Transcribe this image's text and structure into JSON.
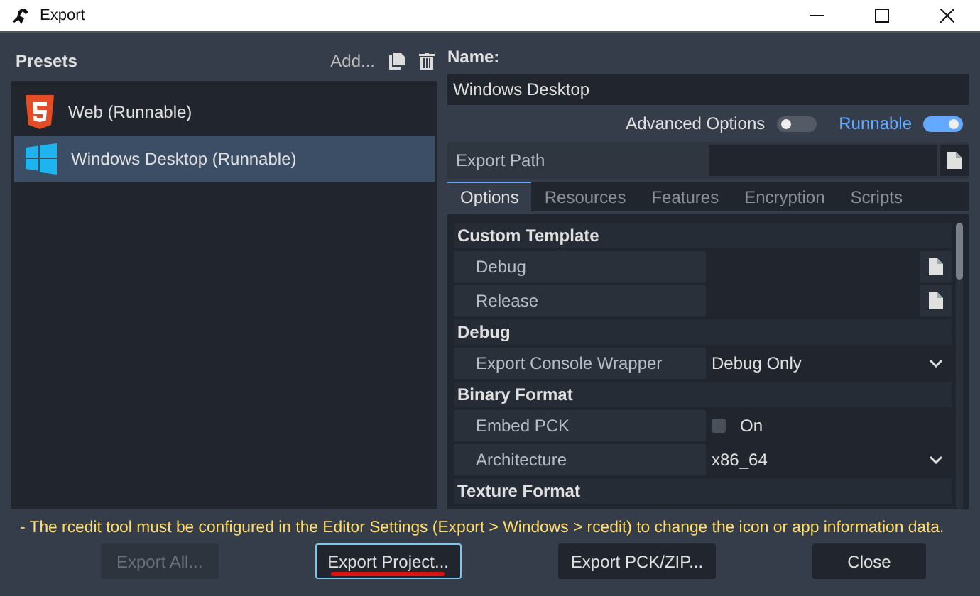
{
  "window": {
    "title": "Export"
  },
  "presets": {
    "title": "Presets",
    "add_label": "Add...",
    "items": [
      {
        "label": "Web (Runnable)",
        "kind": "html5",
        "selected": false
      },
      {
        "label": "Windows Desktop (Runnable)",
        "kind": "windows",
        "selected": true
      }
    ]
  },
  "name": {
    "label": "Name:",
    "value": "Windows Desktop"
  },
  "toggles": [
    {
      "label": "Advanced Options",
      "on": false
    },
    {
      "label": "Runnable",
      "on": true
    }
  ],
  "export_path": {
    "label": "Export Path"
  },
  "tabs": [
    {
      "label": "Options",
      "selected": true
    },
    {
      "label": "Resources",
      "selected": false
    },
    {
      "label": "Features",
      "selected": false
    },
    {
      "label": "Encryption",
      "selected": false
    },
    {
      "label": "Scripts",
      "selected": false
    }
  ],
  "properties": [
    {
      "kind": "section",
      "label": "Custom Template"
    },
    {
      "kind": "file",
      "label": "Debug"
    },
    {
      "kind": "file",
      "label": "Release"
    },
    {
      "kind": "section",
      "label": "Debug"
    },
    {
      "kind": "dropdown",
      "label": "Export Console Wrapper",
      "value": "Debug Only"
    },
    {
      "kind": "section",
      "label": "Binary Format"
    },
    {
      "kind": "checkbox",
      "label": "Embed PCK",
      "value": "On",
      "checked": false
    },
    {
      "kind": "dropdown",
      "label": "Architecture",
      "value": "x86_64"
    },
    {
      "kind": "section",
      "label": "Texture Format"
    }
  ],
  "warning": "- The rcedit tool must be configured in the Editor Settings (Export > Windows > rcedit) to change the icon or app information data.",
  "buttons": [
    {
      "label": "Export All...",
      "disabled": true,
      "focused": false
    },
    {
      "label": "Export Project...",
      "disabled": false,
      "focused": true
    },
    {
      "label": "Export PCK/ZIP...",
      "disabled": false,
      "focused": false
    },
    {
      "label": "Close",
      "disabled": false,
      "focused": false
    }
  ]
}
